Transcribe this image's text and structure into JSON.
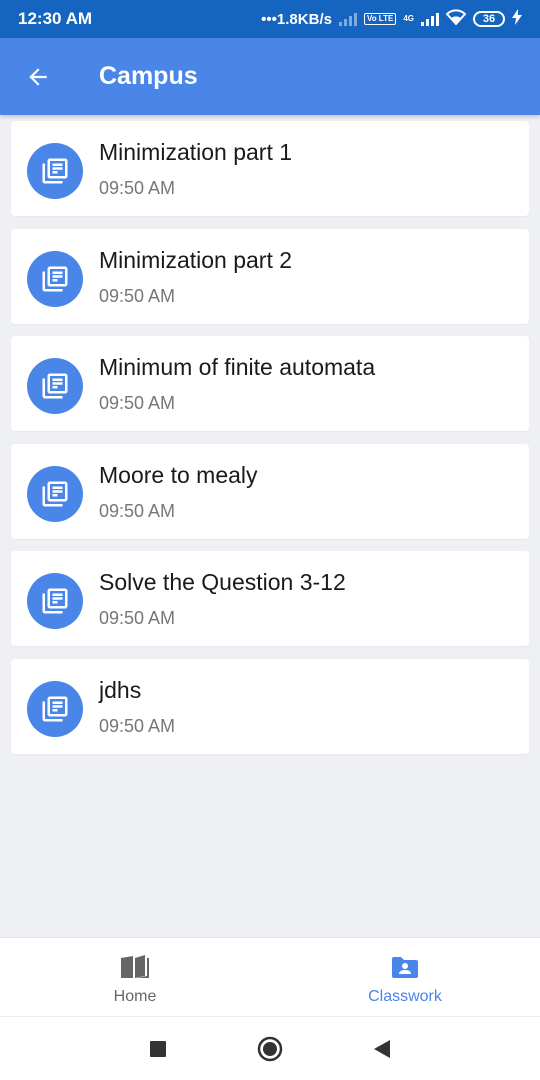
{
  "status_bar": {
    "time": "12:30 AM",
    "net_speed": "•••1.8KB/s",
    "volte_tag": "Vo LTE",
    "net_type": "4G",
    "battery": "36"
  },
  "app_bar": {
    "title": "Campus"
  },
  "items": [
    {
      "title": "Minimization part 1",
      "time": "09:50 AM"
    },
    {
      "title": "Minimization part 2",
      "time": "09:50 AM"
    },
    {
      "title": "Minimum of finite automata",
      "time": "09:50 AM"
    },
    {
      "title": "Moore to mealy",
      "time": "09:50 AM"
    },
    {
      "title": "Solve the Question 3-12",
      "time": "09:50 AM"
    },
    {
      "title": "jdhs",
      "time": "09:50 AM"
    }
  ],
  "bottom_nav": {
    "home_label": "Home",
    "classwork_label": "Classwork",
    "active": "classwork"
  },
  "colors": {
    "status_bar": "#1565c0",
    "accent": "#4a86e8",
    "background": "#eef0f4"
  },
  "icons": {
    "back": "arrow-left-icon",
    "item": "library-books-icon",
    "home": "book-open-icon",
    "classwork": "folder-account-icon"
  }
}
